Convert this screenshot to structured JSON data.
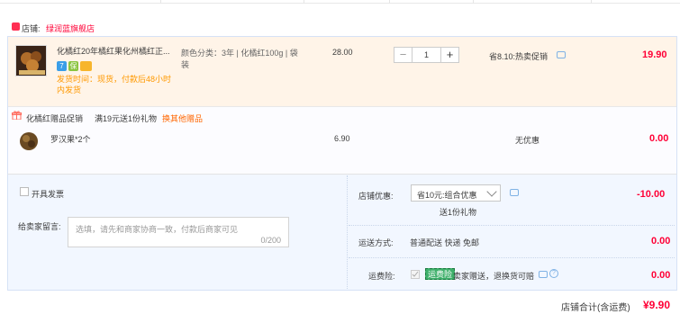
{
  "shop": {
    "label": "店铺:",
    "name": "绿润蓝旗舰店"
  },
  "items": [
    {
      "title": "化橘红20年橘红果化州橘红正...",
      "ship_time": "发货时间：现货，付款后48小时内发货",
      "sku": "颜色分类：3年 | 化橘红100g | 袋装",
      "unit_price": "28.00",
      "quantity": "1",
      "minus": "−",
      "plus": "+",
      "promo": "省8.10:热卖促销",
      "subtotal": "19.90",
      "badges": [
        {
          "label": "7",
          "color": "#3a9ee8"
        },
        {
          "label": "保",
          "color": "#8ac43f"
        },
        {
          "label": "",
          "color": "#f7b52c"
        }
      ]
    }
  ],
  "gift": {
    "title": "化橘红赠品促销",
    "rule": "满19元送1份礼物",
    "change_link": "换其他赠品",
    "item_name": "罗汉果*2个",
    "price": "6.90",
    "promo": "无优惠",
    "subtotal": "0.00"
  },
  "invoice": {
    "label": "开具发票"
  },
  "message": {
    "label": "给卖家留言:",
    "placeholder": "选填，请先和商家协商一致，付款后商家可见",
    "counter": "0/200"
  },
  "shop_discount": {
    "label": "店铺优惠:",
    "selected": "省10元:组合优惠",
    "note": "送1份礼物",
    "amount": "-10.00"
  },
  "shipping": {
    "label": "运送方式:",
    "method": "普通配送 快递 免邮",
    "amount": "0.00"
  },
  "insurance": {
    "label": "运费险:",
    "tag": "运费险",
    "text": "卖家赠送，退换货可赔",
    "amount": "0.00"
  },
  "total": {
    "label": "店铺合计(含运费)",
    "amount": "¥9.90"
  },
  "colors": {
    "accent_red": "#ff0036",
    "orange": "#ff6600",
    "item_bg": "#fff4e8",
    "panel_bg": "#f2f7ff"
  }
}
